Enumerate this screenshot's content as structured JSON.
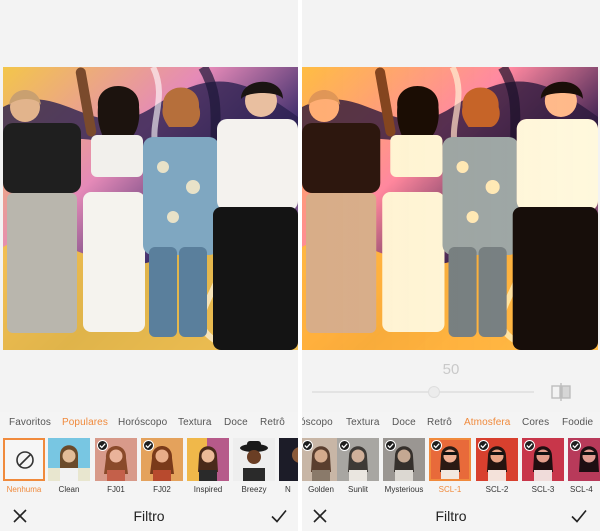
{
  "left_panel": {
    "tabs": [
      {
        "label": "Favoritos",
        "active": false
      },
      {
        "label": "Populares",
        "active": true
      },
      {
        "label": "Horóscopo",
        "active": false
      },
      {
        "label": "Textura",
        "active": false
      },
      {
        "label": "Doce",
        "active": false
      },
      {
        "label": "Retrô",
        "active": false
      }
    ],
    "filters": [
      {
        "label": "Nenhuma",
        "checked": false,
        "selected": true,
        "kind": "none"
      },
      {
        "label": "Clean",
        "checked": false,
        "selected": false
      },
      {
        "label": "FJ01",
        "checked": true,
        "selected": false
      },
      {
        "label": "FJ02",
        "checked": true,
        "selected": false
      },
      {
        "label": "Inspired",
        "checked": false,
        "selected": false
      },
      {
        "label": "Breezy",
        "checked": false,
        "selected": false
      },
      {
        "label": "N",
        "checked": false,
        "selected": false
      }
    ],
    "title": "Filtro"
  },
  "right_panel": {
    "slider_value": "50",
    "tabs": [
      {
        "label": "óscopo",
        "active": false
      },
      {
        "label": "Textura",
        "active": false
      },
      {
        "label": "Doce",
        "active": false
      },
      {
        "label": "Retrô",
        "active": false
      },
      {
        "label": "Atmosfera",
        "active": true
      },
      {
        "label": "Cores",
        "active": false
      },
      {
        "label": "Foodie",
        "active": false
      }
    ],
    "filters": [
      {
        "label": "Golden",
        "checked": true,
        "selected": false
      },
      {
        "label": "Sunlit",
        "checked": true,
        "selected": false
      },
      {
        "label": "Mysterious",
        "checked": true,
        "selected": false
      },
      {
        "label": "SCL-1",
        "checked": true,
        "selected": true
      },
      {
        "label": "SCL-2",
        "checked": true,
        "selected": false
      },
      {
        "label": "SCL-3",
        "checked": true,
        "selected": false
      },
      {
        "label": "SCL-4",
        "checked": true,
        "selected": false
      }
    ],
    "title": "Filtro"
  },
  "colors": {
    "accent": "#f08a3c",
    "text": "#222222",
    "background": "#f4f4f4"
  },
  "icons": {
    "cancel": "close-icon",
    "confirm": "checkmark-icon",
    "compare": "compare-icon",
    "none": "no-filter-icon"
  }
}
